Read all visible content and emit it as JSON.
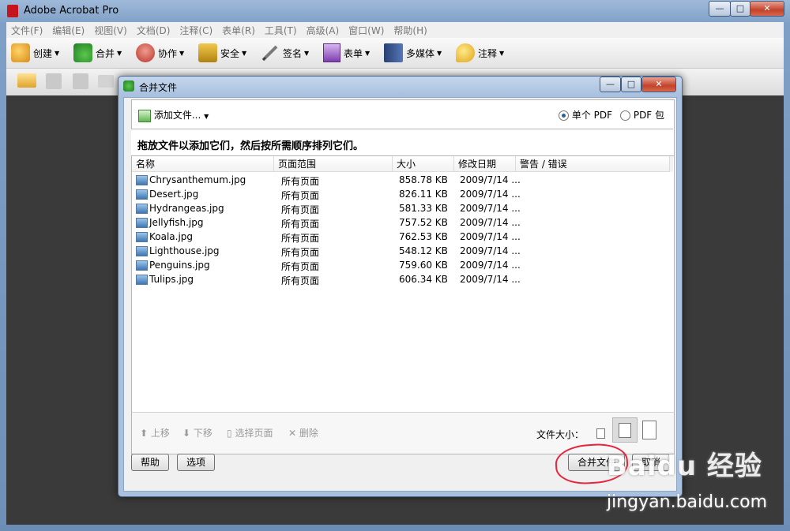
{
  "app": {
    "title": "Adobe Acrobat Pro"
  },
  "window_controls": {
    "minimize": "—",
    "maximize": "□",
    "close": "✕"
  },
  "menu": [
    "文件(F)",
    "编辑(E)",
    "视图(V)",
    "文档(D)",
    "注释(C)",
    "表单(R)",
    "工具(T)",
    "高级(A)",
    "窗口(W)",
    "帮助(H)"
  ],
  "toolbar": [
    {
      "label": "创建",
      "icon": "create-icon"
    },
    {
      "label": "合并",
      "icon": "combine-icon"
    },
    {
      "label": "协作",
      "icon": "collaborate-icon"
    },
    {
      "label": "安全",
      "icon": "lock-icon"
    },
    {
      "label": "签名",
      "icon": "pen-icon"
    },
    {
      "label": "表单",
      "icon": "form-icon"
    },
    {
      "label": "多媒体",
      "icon": "film-icon"
    },
    {
      "label": "注释",
      "icon": "comment-icon"
    }
  ],
  "dialog": {
    "title": "合并文件",
    "add_files": "添加文件...",
    "radio_single": "单个 PDF",
    "radio_package": "PDF 包",
    "instruction": "拖放文件以添加它们，然后按所需顺序排列它们。",
    "columns": [
      "名称",
      "页面范围",
      "大小",
      "修改日期",
      "警告 / 错误"
    ],
    "files": [
      {
        "name": "Chrysanthemum.jpg",
        "range": "所有页面",
        "size": "858.78 KB",
        "date": "2009/7/14 ..."
      },
      {
        "name": "Desert.jpg",
        "range": "所有页面",
        "size": "826.11 KB",
        "date": "2009/7/14 ..."
      },
      {
        "name": "Hydrangeas.jpg",
        "range": "所有页面",
        "size": "581.33 KB",
        "date": "2009/7/14 ..."
      },
      {
        "name": "Jellyfish.jpg",
        "range": "所有页面",
        "size": "757.52 KB",
        "date": "2009/7/14 ..."
      },
      {
        "name": "Koala.jpg",
        "range": "所有页面",
        "size": "762.53 KB",
        "date": "2009/7/14 ..."
      },
      {
        "name": "Lighthouse.jpg",
        "range": "所有页面",
        "size": "548.12 KB",
        "date": "2009/7/14 ..."
      },
      {
        "name": "Penguins.jpg",
        "range": "所有页面",
        "size": "759.60 KB",
        "date": "2009/7/14 ..."
      },
      {
        "name": "Tulips.jpg",
        "range": "所有页面",
        "size": "606.34 KB",
        "date": "2009/7/14 ..."
      }
    ],
    "move_up": "上移",
    "move_down": "下移",
    "choose_pages": "选择页面",
    "remove": "删除",
    "file_size_label": "文件大小：",
    "help": "帮助",
    "options": "选项",
    "combine": "合并文件",
    "cancel": "取消"
  },
  "watermark": {
    "brand": "Baidu 经验",
    "url": "jingyan.baidu.com"
  },
  "colors": {
    "annotation_circle": "#e8233a",
    "title_gradient": "#a9c1df"
  }
}
